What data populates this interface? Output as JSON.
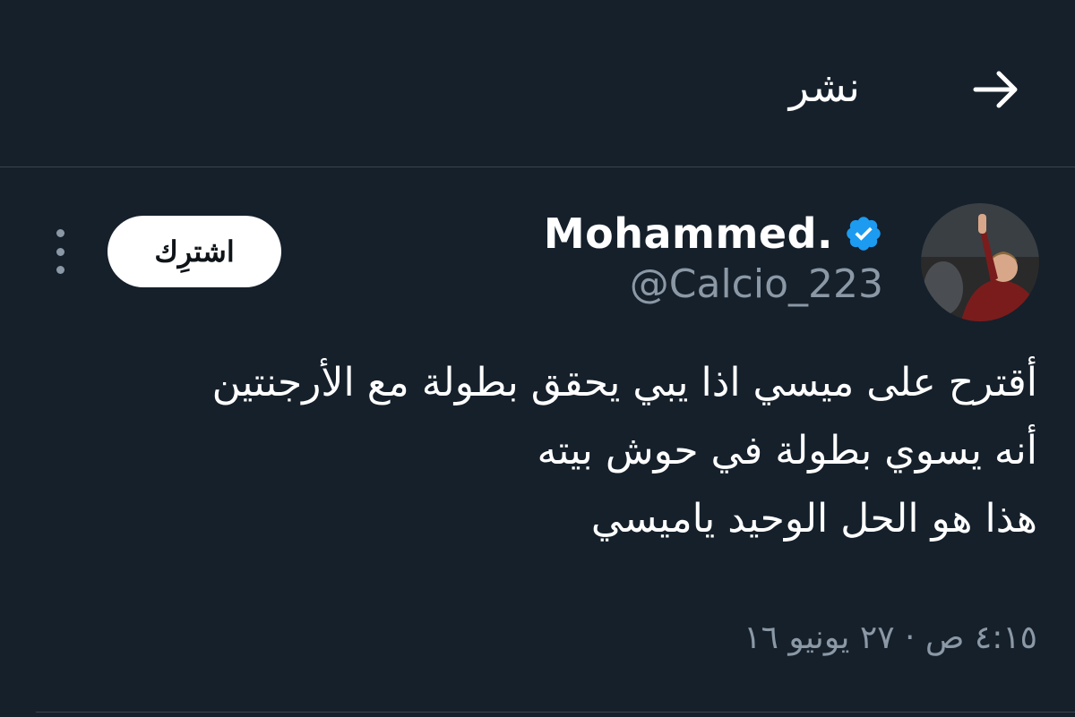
{
  "header": {
    "title": "نشر",
    "back_icon": "arrow-right-icon"
  },
  "author": {
    "display_name": "Mohammed.",
    "handle": "@Calcio_223",
    "verified_icon": "verified-badge-icon",
    "verified_color": "#1d9bf0"
  },
  "actions": {
    "subscribe_label": "اشترِك",
    "more_icon": "more-vertical-icon"
  },
  "tweet": {
    "lines": [
      "أقترح على ميسي اذا يبي يحقق بطولة مع الأرجنتين",
      "أنه يسوي بطولة في حوش بيته",
      "هذا هو الحل الوحيد ياميسي"
    ],
    "timestamp": "٤:١٥ ص · ٢٧ يونيو ١٦"
  },
  "colors": {
    "background": "#15202b",
    "divider": "#38444d",
    "secondary_text": "#8b98a5",
    "primary_text": "#ffffff"
  }
}
